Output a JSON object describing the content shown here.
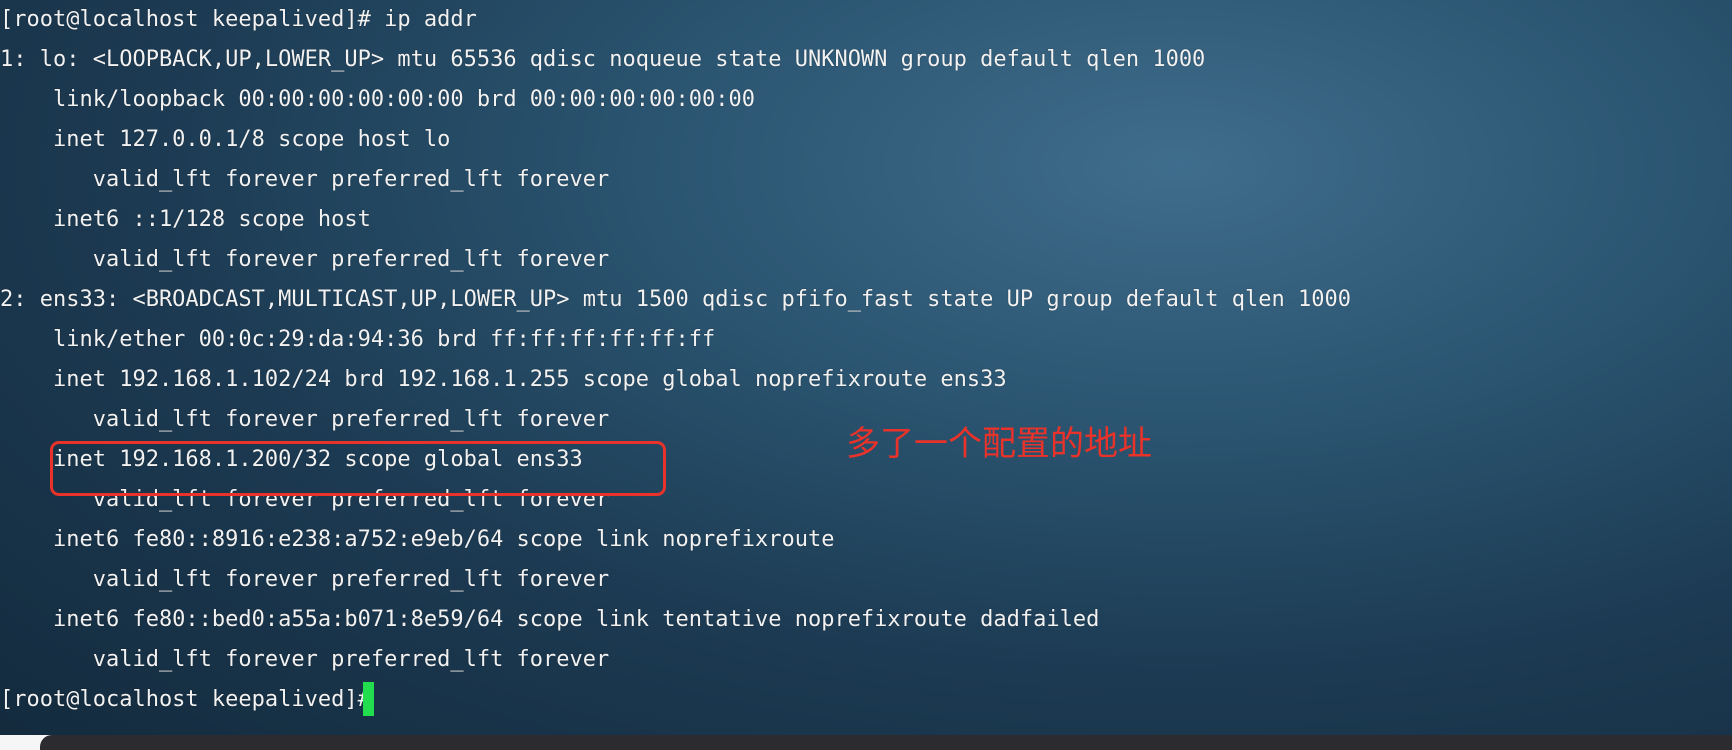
{
  "terminal": {
    "lines": [
      "[root@localhost keepalived]# ip addr",
      "1: lo: <LOOPBACK,UP,LOWER_UP> mtu 65536 qdisc noqueue state UNKNOWN group default qlen 1000",
      "    link/loopback 00:00:00:00:00:00 brd 00:00:00:00:00:00",
      "    inet 127.0.0.1/8 scope host lo",
      "       valid_lft forever preferred_lft forever",
      "    inet6 ::1/128 scope host",
      "       valid_lft forever preferred_lft forever",
      "2: ens33: <BROADCAST,MULTICAST,UP,LOWER_UP> mtu 1500 qdisc pfifo_fast state UP group default qlen 1000",
      "    link/ether 00:0c:29:da:94:36 brd ff:ff:ff:ff:ff:ff",
      "    inet 192.168.1.102/24 brd 192.168.1.255 scope global noprefixroute ens33",
      "       valid_lft forever preferred_lft forever",
      "    inet 192.168.1.200/32 scope global ens33",
      "       valid_lft forever preferred_lft forever",
      "    inet6 fe80::8916:e238:a752:e9eb/64 scope link noprefixroute",
      "       valid_lft forever preferred_lft forever",
      "    inet6 fe80::bed0:a55a:b071:8e59/64 scope link tentative noprefixroute dadfailed",
      "       valid_lft forever preferred_lft forever",
      "[root@localhost keepalived]# "
    ]
  },
  "annotation": {
    "text": "多了一个配置的地址",
    "color": "#e8322a"
  },
  "colors": {
    "text": "#f2f2f2",
    "cursor": "#22dd4d",
    "highlight": "#e8322a"
  }
}
